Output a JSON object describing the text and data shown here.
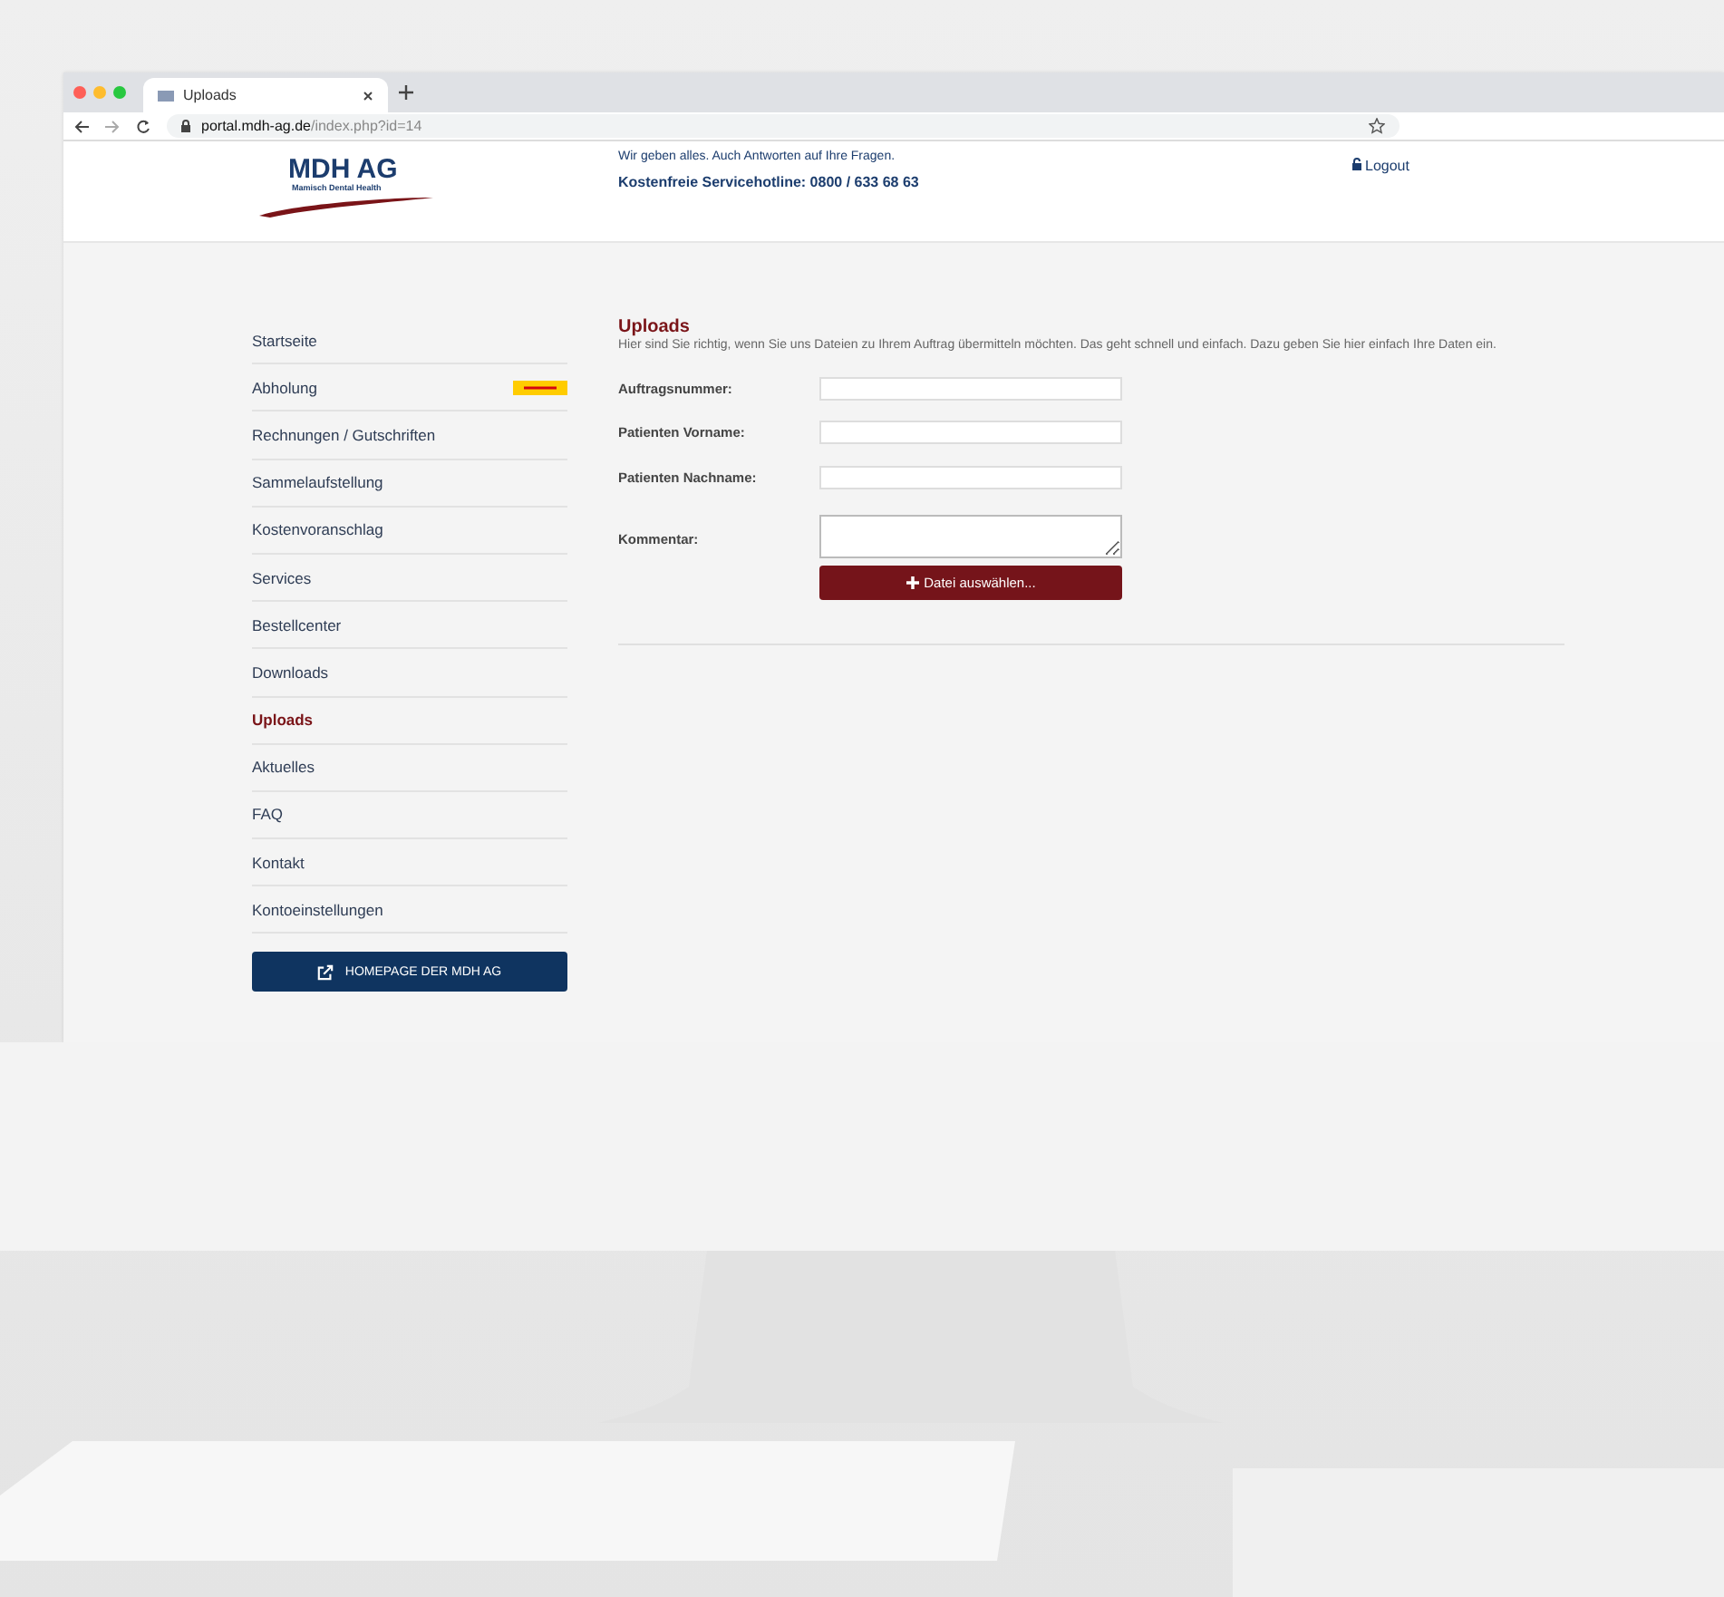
{
  "browser": {
    "tabs": [
      {
        "label": "Uploads",
        "selected": true
      }
    ],
    "url_host": "portal.mdh-ag.de",
    "url_path": "/index.php?id=14"
  },
  "header": {
    "logo_title": "MDH AG",
    "logo_subtitle": "Mamisch Dental Health",
    "tagline": "Wir geben alles. Auch Antworten auf Ihre Fragen.",
    "hotline": "Kostenfreie Servicehotline: 0800 / 633 68 63",
    "logout": "Logout"
  },
  "sidebar": {
    "items": [
      {
        "label": "Startseite",
        "selected": false,
        "kind": "plain"
      },
      {
        "label": "Abholung",
        "selected": false,
        "kind": "dhl"
      },
      {
        "label": "Rechnungen / Gutschriften",
        "selected": false,
        "kind": "plain"
      },
      {
        "label": "Sammelaufstellung",
        "selected": false,
        "kind": "plain"
      },
      {
        "label": "Kostenvoranschlag",
        "selected": false,
        "kind": "plain"
      },
      {
        "label": "Services",
        "selected": false,
        "kind": "plain"
      },
      {
        "label": "Bestellcenter",
        "selected": false,
        "kind": "plain"
      },
      {
        "label": "Downloads",
        "selected": false,
        "kind": "plain"
      },
      {
        "label": "Uploads",
        "selected": true,
        "kind": "plain"
      },
      {
        "label": "Aktuelles",
        "selected": false,
        "kind": "plain"
      },
      {
        "label": "FAQ",
        "selected": false,
        "kind": "plain"
      },
      {
        "label": "Kontakt",
        "selected": false,
        "kind": "plain"
      },
      {
        "label": "Kontoeinstellungen",
        "selected": false,
        "kind": "plain"
      }
    ],
    "homepage_button": "HOMEPAGE DER MDH AG"
  },
  "form": {
    "title": "Uploads",
    "intro": "Hier sind Sie richtig, wenn Sie uns Dateien zu Ihrem Auftrag übermitteln möchten. Das geht schnell und einfach. Dazu geben Sie hier einfach Ihre Daten ein.",
    "fields": [
      {
        "label": "Auftragsnummer:",
        "kind": "text"
      },
      {
        "label": "Patienten Vorname:",
        "kind": "text"
      },
      {
        "label": "Patienten Nachname:",
        "kind": "text"
      },
      {
        "label": "Kommentar:",
        "kind": "textarea"
      }
    ],
    "file_button": "Datei auswählen..."
  }
}
